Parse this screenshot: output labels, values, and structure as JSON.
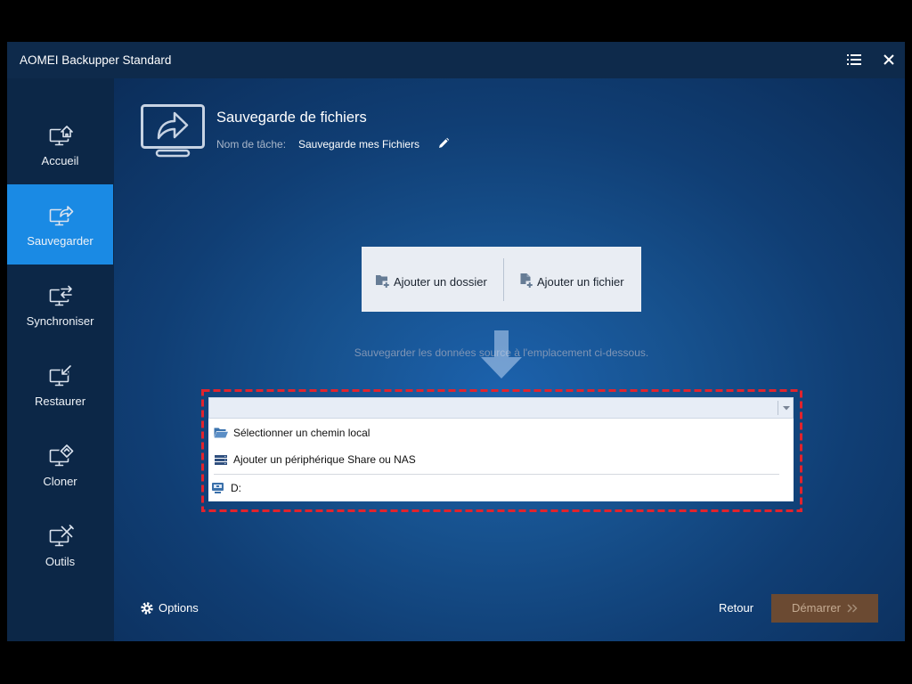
{
  "window": {
    "title": "AOMEI Backupper Standard",
    "menu_icon": "menu-list-icon",
    "close_icon": "close-icon"
  },
  "sidebar": {
    "items": [
      {
        "label": "Accueil",
        "icon": "home-monitor-icon",
        "active": false
      },
      {
        "label": "Sauvegarder",
        "icon": "backup-monitor-icon",
        "active": true
      },
      {
        "label": "Synchroniser",
        "icon": "sync-monitor-icon",
        "active": false
      },
      {
        "label": "Restaurer",
        "icon": "restore-monitor-icon",
        "active": false
      },
      {
        "label": "Cloner",
        "icon": "clone-monitor-icon",
        "active": false
      },
      {
        "label": "Outils",
        "icon": "tools-monitor-icon",
        "active": false
      }
    ]
  },
  "header": {
    "icon": "file-backup-monitor-icon",
    "title": "Sauvegarde de fichiers",
    "task_name_label": "Nom de tâche:",
    "task_name_value": "Sauvegarde mes Fichiers",
    "edit_icon": "pencil-icon"
  },
  "source": {
    "add_folder": {
      "label": "Ajouter un dossier",
      "icon": "folder-add-icon"
    },
    "add_file": {
      "label": "Ajouter un fichier",
      "icon": "file-add-icon"
    },
    "flow_icon": "arrow-down-icon"
  },
  "destination": {
    "hint": "Sauvegarder les données source à l'emplacement ci-dessous.",
    "selected_value": "",
    "dropdown_icon": "caret-down-icon",
    "options": [
      {
        "label": "Sélectionner un chemin local",
        "icon": "folder-open-icon"
      },
      {
        "label": "Ajouter un périphérique Share ou NAS",
        "icon": "nas-server-icon"
      },
      {
        "label": "D:",
        "icon": "drive-icon"
      }
    ]
  },
  "footer": {
    "options": {
      "label": "Options",
      "icon": "gear-icon"
    },
    "back_label": "Retour",
    "start": {
      "label": "Démarrer",
      "icon": "double-chevron-right-icon"
    }
  },
  "theme": {
    "accent": "#1a8ae4",
    "titlebar": "#0e2a4b",
    "sidebar": "#0c2747",
    "highlight": "#e3232c",
    "start_button": "#6b4a32",
    "start_text": "#c4ab92"
  }
}
